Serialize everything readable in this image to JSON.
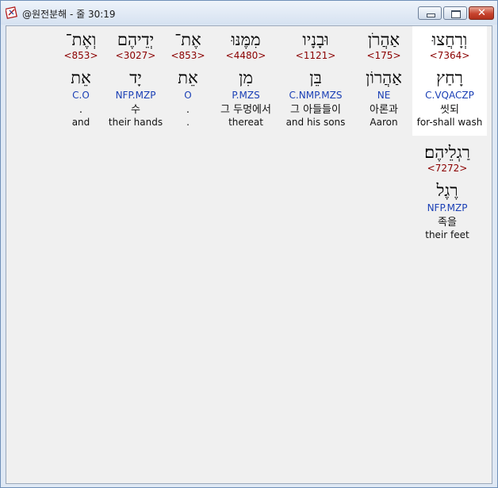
{
  "window": {
    "title": "@원전분해 - 줄 30:19",
    "app_icon": "bible-book-icon",
    "minimize_icon": "minimize-icon",
    "maximize_icon": "restore-icon",
    "close_icon": "close-icon",
    "close_glyph": "✕"
  },
  "words": [
    {
      "hebrew": "וְרָחֲצוּ",
      "strong": "<7364>",
      "lemma": "רָחַץ",
      "morph": "C.VQACZP",
      "korean": "씻되",
      "english": "for-shall wash",
      "highlighted": true
    },
    {
      "hebrew": "אַהֲרֹן",
      "strong": "<175>",
      "lemma": "אַהֲרוֹן",
      "morph": "NE",
      "korean": "아론과",
      "english": "Aaron"
    },
    {
      "hebrew": "וּבָנָיו",
      "strong": "<1121>",
      "lemma": "בֵּן",
      "morph": "C.NMP.MZS",
      "korean": "그 아들들이",
      "english": "and his sons"
    },
    {
      "hebrew": "מִמֶּנּוּ",
      "strong": "<4480>",
      "lemma": "מִן",
      "morph": "P.MZS",
      "korean": "그 두멍에서",
      "english": "thereat"
    },
    {
      "hebrew": "אֶת־",
      "strong": "<853>",
      "lemma": "אֵת",
      "morph": "O",
      "korean": ".",
      "english": "."
    },
    {
      "hebrew": "יְדֵיהֶם",
      "strong": "<3027>",
      "lemma": "יָד",
      "morph": "NFP.MZP",
      "korean": "수",
      "english": "their hands"
    },
    {
      "hebrew": "וְאֶת־",
      "strong": "<853>",
      "lemma": "אֵת",
      "morph": "C.O",
      "korean": ".",
      "english": "and"
    },
    {
      "hebrew": "רַגְלֵיהֶם׃",
      "strong": "<7272>",
      "lemma": "רֶגֶל",
      "morph": "NFP.MZP",
      "korean": "족을",
      "english": "their feet"
    }
  ]
}
